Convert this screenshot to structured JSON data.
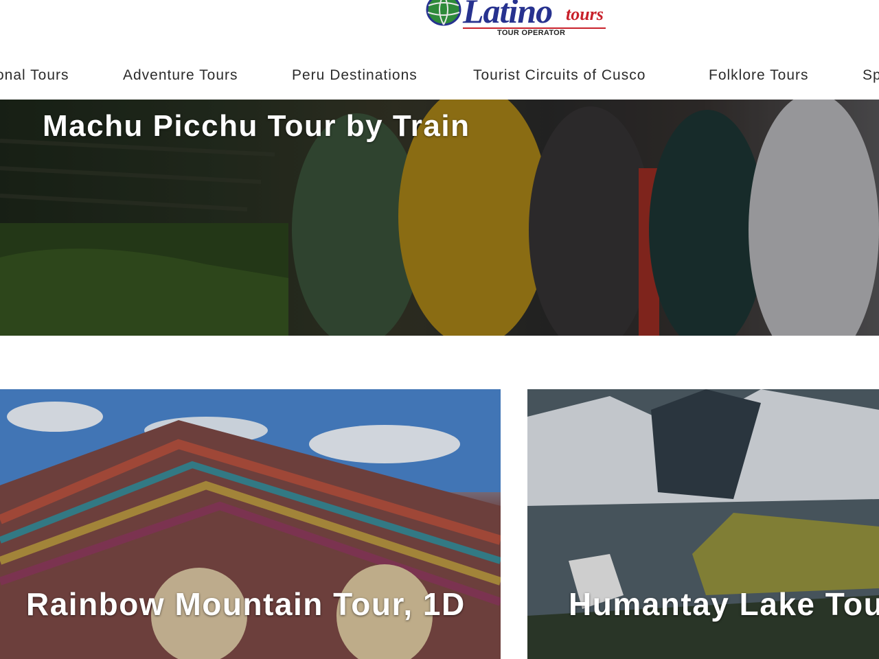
{
  "header": {
    "logo": {
      "main": "Latino",
      "accent": "tours",
      "subtitle": "TOUR OPERATOR",
      "colors": {
        "brand_blue": "#27328f",
        "brand_red": "#c8202a"
      }
    },
    "nav": {
      "items": [
        {
          "label": "onal Tours"
        },
        {
          "label": "Adventure Tours"
        },
        {
          "label": "Peru Destinations"
        },
        {
          "label": "Tourist Circuits of Cusco"
        },
        {
          "label": "Folklore Tours"
        },
        {
          "label": "Sp"
        }
      ]
    }
  },
  "hero": {
    "title": "Machu Picchu Tour by Train"
  },
  "cards": [
    {
      "title": "Rainbow Mountain Tour, 1D"
    },
    {
      "title": "Humantay Lake Tou"
    }
  ]
}
